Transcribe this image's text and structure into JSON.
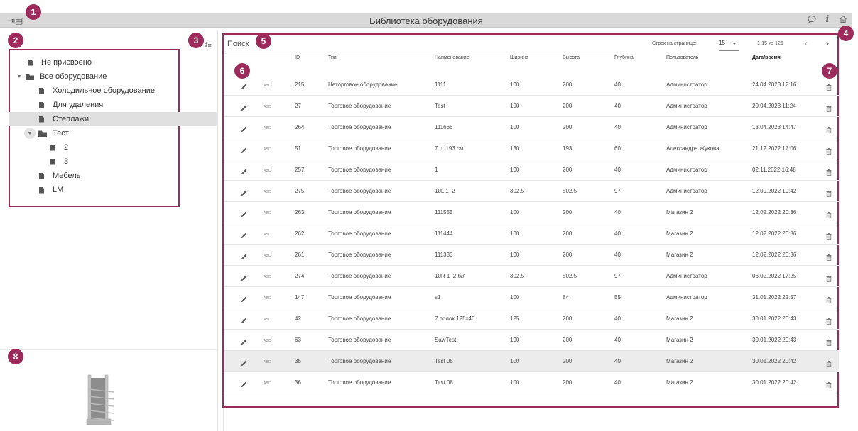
{
  "titlebar": {
    "title": "Библиотека оборудования",
    "left_icon": "sidebar-toggle-icon",
    "right_icons": [
      "comment-icon",
      "info-icon",
      "home-icon"
    ]
  },
  "markers": [
    "1",
    "2",
    "3",
    "4",
    "5",
    "6",
    "7",
    "8"
  ],
  "tree": {
    "items": [
      {
        "label": "Не присвоено",
        "type": "file"
      },
      {
        "label": "Все оборудование",
        "type": "folder"
      },
      {
        "label": "Холодильное оборудование",
        "type": "file"
      },
      {
        "label": "Для удаления",
        "type": "file"
      },
      {
        "label": "Стеллажи",
        "type": "file",
        "selected": true
      },
      {
        "label": "Тест",
        "type": "folder"
      },
      {
        "label": "2",
        "type": "file"
      },
      {
        "label": "3",
        "type": "file"
      },
      {
        "label": "Мебель",
        "type": "file"
      },
      {
        "label": "LM",
        "type": "file"
      }
    ]
  },
  "toolbar": {
    "search_label": "Поиск",
    "rows_per_page_label": "Строк на странице:",
    "rows_per_page_value": "15",
    "range": "1-15 из 126",
    "prev": "‹",
    "next": "›"
  },
  "table": {
    "headers": {
      "id": "ID",
      "type": "Тип",
      "name": "Наименование",
      "width": "Ширина",
      "height": "Высота",
      "depth": "Глубина",
      "user": "Пользователь",
      "datetime": "Дата/время",
      "sort_arrow": "↑"
    },
    "abc_label": "ABC",
    "rows": [
      {
        "id": "215",
        "type": "Неторговое оборудование",
        "name": "1111",
        "width": "100",
        "height": "200",
        "depth": "40",
        "user": "Администратор",
        "datetime": "24.04.2023 12:16"
      },
      {
        "id": "27",
        "type": "Торговое оборудование",
        "name": "Test",
        "width": "100",
        "height": "200",
        "depth": "40",
        "user": "Администратор",
        "datetime": "20.04.2023 11:24"
      },
      {
        "id": "264",
        "type": "Торговое оборудование",
        "name": "111666",
        "width": "100",
        "height": "200",
        "depth": "40",
        "user": "Администратор",
        "datetime": "13.04.2023 14:47"
      },
      {
        "id": "51",
        "type": "Торговое оборудование",
        "name": "7 п. 193 см",
        "width": "130",
        "height": "193",
        "depth": "60",
        "user": "Александра Жукова",
        "datetime": "21.12.2022 17:06"
      },
      {
        "id": "257",
        "type": "Торговое оборудование",
        "name": "1",
        "width": "100",
        "height": "200",
        "depth": "40",
        "user": "Администратор",
        "datetime": "02.11.2022 16:48"
      },
      {
        "id": "275",
        "type": "Торговое оборудование",
        "name": "10L 1_2",
        "width": "302.5",
        "height": "502.5",
        "depth": "97",
        "user": "Администратор",
        "datetime": "12.09.2022 19:42"
      },
      {
        "id": "263",
        "type": "Торговое оборудование",
        "name": "111555",
        "width": "100",
        "height": "200",
        "depth": "40",
        "user": "Магазин 2",
        "datetime": "12.02.2022 20:36"
      },
      {
        "id": "262",
        "type": "Торговое оборудование",
        "name": "111444",
        "width": "100",
        "height": "200",
        "depth": "40",
        "user": "Магазин 2",
        "datetime": "12.02.2022 20:36"
      },
      {
        "id": "261",
        "type": "Торговое оборудование",
        "name": "111333",
        "width": "100",
        "height": "200",
        "depth": "40",
        "user": "Магазин 2",
        "datetime": "12.02.2022 20:36"
      },
      {
        "id": "274",
        "type": "Торговое оборудование",
        "name": "10R 1_2 б/я",
        "width": "302.5",
        "height": "502.5",
        "depth": "97",
        "user": "Администратор",
        "datetime": "06.02.2022 17:25"
      },
      {
        "id": "147",
        "type": "Торговое оборудование",
        "name": "s1",
        "width": "100",
        "height": "84",
        "depth": "55",
        "user": "Администратор",
        "datetime": "31.01.2022 22:57"
      },
      {
        "id": "42",
        "type": "Торговое оборудование",
        "name": "7 полок 125х40",
        "width": "125",
        "height": "200",
        "depth": "40",
        "user": "Магазин 2",
        "datetime": "30.01.2022 20:43"
      },
      {
        "id": "63",
        "type": "Торговое оборудование",
        "name": "SawTest",
        "width": "100",
        "height": "200",
        "depth": "40",
        "user": "Магазин 2",
        "datetime": "30.01.2022 20:43"
      },
      {
        "id": "35",
        "type": "Торговое оборудование",
        "name": "Test 05",
        "width": "100",
        "height": "200",
        "depth": "40",
        "user": "Магазин 2",
        "datetime": "30.01.2022 20:42",
        "highlight": true
      },
      {
        "id": "36",
        "type": "Торговое оборудование",
        "name": "Test 08",
        "width": "100",
        "height": "200",
        "depth": "40",
        "user": "Магазин 2",
        "datetime": "30.01.2022 20:42"
      }
    ]
  },
  "colors": {
    "accent": "#9c2a5a",
    "titlebar_bg": "#d9d9d9",
    "selected_bg": "#e0e0e0"
  }
}
